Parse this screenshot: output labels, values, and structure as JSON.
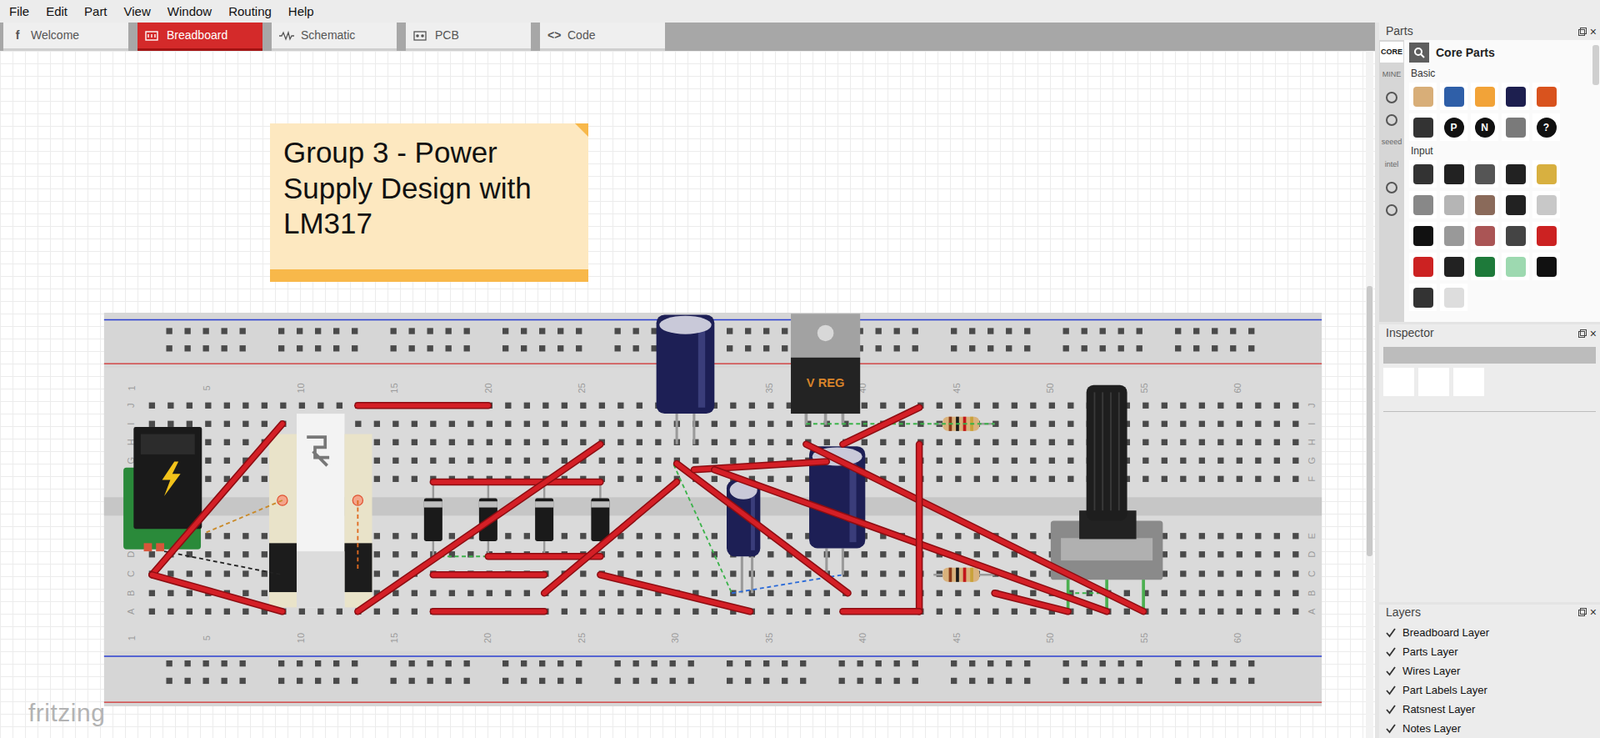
{
  "menu": [
    "File",
    "Edit",
    "Part",
    "View",
    "Window",
    "Routing",
    "Help"
  ],
  "tabs": [
    {
      "label": "Welcome",
      "selected": false,
      "glyph": "f"
    },
    {
      "label": "Breadboard",
      "selected": true
    },
    {
      "label": "Schematic",
      "selected": false
    },
    {
      "label": "PCB",
      "selected": false
    },
    {
      "label": "Code",
      "selected": false,
      "glyph": "<>"
    }
  ],
  "note": {
    "text": "Group 3 - Power Supply Design with LM317"
  },
  "breadboard": {
    "column_labels": [
      "1",
      "5",
      "10",
      "15",
      "20",
      "25",
      "30",
      "35",
      "40",
      "45",
      "50",
      "55",
      "60"
    ],
    "row_labels": [
      "J",
      "I",
      "H",
      "G",
      "F",
      "E",
      "D",
      "C",
      "B",
      "A"
    ],
    "regulator_label": "V REG"
  },
  "watermark": "fritzing",
  "parts_panel": {
    "title": "Parts",
    "close": "×",
    "bins": [
      {
        "label": "CORE",
        "selected": true
      },
      {
        "label": "MINE",
        "selected": false
      },
      {
        "selected": false
      },
      {
        "selected": false
      },
      {
        "label": "seeed",
        "selected": false
      },
      {
        "label": "intel",
        "selected": false
      },
      {
        "selected": false
      },
      {
        "selected": false
      }
    ],
    "bin_title": "Core Parts",
    "sections": [
      {
        "label": "Basic",
        "items": [
          {
            "color": "#d8ae78"
          },
          {
            "color": "#2f5fa8"
          },
          {
            "color": "#f2a338"
          },
          {
            "color": "#1d1f4f"
          },
          {
            "color": "#d9531e"
          },
          {
            "color": "#333333"
          },
          {
            "color": "#111111",
            "glyph": "P"
          },
          {
            "color": "#111111",
            "glyph": "N"
          },
          {
            "color": "#7a7a7a"
          },
          {
            "color": "#111111",
            "glyph": "?"
          }
        ]
      },
      {
        "label": "Input",
        "items": [
          {
            "color": "#333333"
          },
          {
            "color": "#222222"
          },
          {
            "color": "#555555"
          },
          {
            "color": "#222222"
          },
          {
            "color": "#d8b040"
          },
          {
            "color": "#888888"
          },
          {
            "color": "#b5b5b5"
          },
          {
            "color": "#8a6a5a"
          },
          {
            "color": "#222222"
          },
          {
            "color": "#c8c8c8"
          },
          {
            "color": "#111111"
          },
          {
            "color": "#999999"
          },
          {
            "color": "#aa5555"
          },
          {
            "color": "#444444"
          },
          {
            "color": "#cc2222"
          },
          {
            "color": "#cc2222"
          },
          {
            "color": "#222222"
          },
          {
            "color": "#1e7a3a"
          },
          {
            "color": "#9dd9b0"
          },
          {
            "color": "#111111"
          },
          {
            "color": "#333333"
          },
          {
            "color": "#dddddd"
          }
        ]
      }
    ]
  },
  "inspector": {
    "title": "Inspector",
    "close": "×"
  },
  "layers": {
    "title": "Layers",
    "close": "×",
    "items": [
      {
        "label": "Breadboard Layer",
        "checked": true
      },
      {
        "label": "Parts Layer",
        "checked": true
      },
      {
        "label": "Wires Layer",
        "checked": true
      },
      {
        "label": "Part Labels Layer",
        "checked": true
      },
      {
        "label": "Ratsnest Layer",
        "checked": true
      },
      {
        "label": "Notes Layer",
        "checked": true
      }
    ]
  }
}
